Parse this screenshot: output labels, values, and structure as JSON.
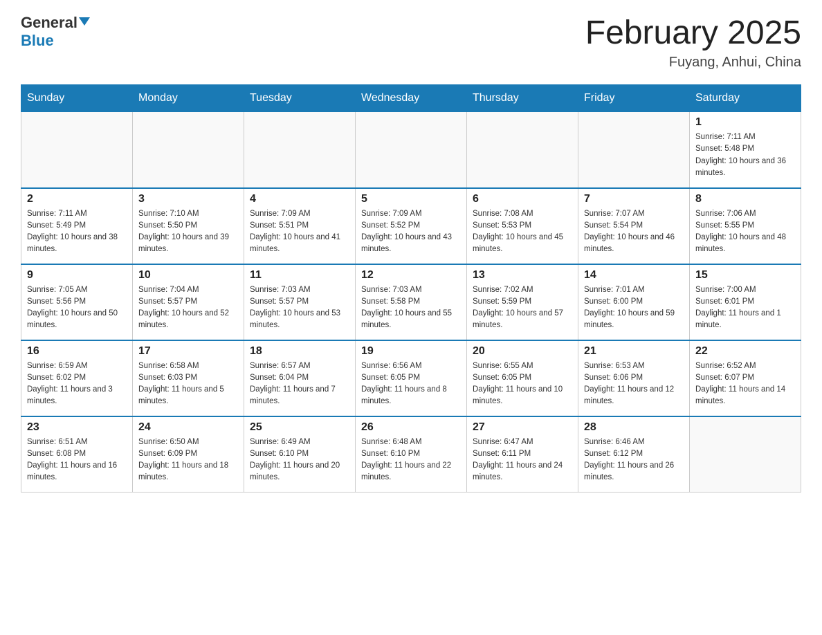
{
  "header": {
    "logo_general": "General",
    "logo_blue": "Blue",
    "month_title": "February 2025",
    "location": "Fuyang, Anhui, China"
  },
  "days_of_week": [
    "Sunday",
    "Monday",
    "Tuesday",
    "Wednesday",
    "Thursday",
    "Friday",
    "Saturday"
  ],
  "weeks": [
    [
      {
        "day": "",
        "sunrise": "",
        "sunset": "",
        "daylight": ""
      },
      {
        "day": "",
        "sunrise": "",
        "sunset": "",
        "daylight": ""
      },
      {
        "day": "",
        "sunrise": "",
        "sunset": "",
        "daylight": ""
      },
      {
        "day": "",
        "sunrise": "",
        "sunset": "",
        "daylight": ""
      },
      {
        "day": "",
        "sunrise": "",
        "sunset": "",
        "daylight": ""
      },
      {
        "day": "",
        "sunrise": "",
        "sunset": "",
        "daylight": ""
      },
      {
        "day": "1",
        "sunrise": "Sunrise: 7:11 AM",
        "sunset": "Sunset: 5:48 PM",
        "daylight": "Daylight: 10 hours and 36 minutes."
      }
    ],
    [
      {
        "day": "2",
        "sunrise": "Sunrise: 7:11 AM",
        "sunset": "Sunset: 5:49 PM",
        "daylight": "Daylight: 10 hours and 38 minutes."
      },
      {
        "day": "3",
        "sunrise": "Sunrise: 7:10 AM",
        "sunset": "Sunset: 5:50 PM",
        "daylight": "Daylight: 10 hours and 39 minutes."
      },
      {
        "day": "4",
        "sunrise": "Sunrise: 7:09 AM",
        "sunset": "Sunset: 5:51 PM",
        "daylight": "Daylight: 10 hours and 41 minutes."
      },
      {
        "day": "5",
        "sunrise": "Sunrise: 7:09 AM",
        "sunset": "Sunset: 5:52 PM",
        "daylight": "Daylight: 10 hours and 43 minutes."
      },
      {
        "day": "6",
        "sunrise": "Sunrise: 7:08 AM",
        "sunset": "Sunset: 5:53 PM",
        "daylight": "Daylight: 10 hours and 45 minutes."
      },
      {
        "day": "7",
        "sunrise": "Sunrise: 7:07 AM",
        "sunset": "Sunset: 5:54 PM",
        "daylight": "Daylight: 10 hours and 46 minutes."
      },
      {
        "day": "8",
        "sunrise": "Sunrise: 7:06 AM",
        "sunset": "Sunset: 5:55 PM",
        "daylight": "Daylight: 10 hours and 48 minutes."
      }
    ],
    [
      {
        "day": "9",
        "sunrise": "Sunrise: 7:05 AM",
        "sunset": "Sunset: 5:56 PM",
        "daylight": "Daylight: 10 hours and 50 minutes."
      },
      {
        "day": "10",
        "sunrise": "Sunrise: 7:04 AM",
        "sunset": "Sunset: 5:57 PM",
        "daylight": "Daylight: 10 hours and 52 minutes."
      },
      {
        "day": "11",
        "sunrise": "Sunrise: 7:03 AM",
        "sunset": "Sunset: 5:57 PM",
        "daylight": "Daylight: 10 hours and 53 minutes."
      },
      {
        "day": "12",
        "sunrise": "Sunrise: 7:03 AM",
        "sunset": "Sunset: 5:58 PM",
        "daylight": "Daylight: 10 hours and 55 minutes."
      },
      {
        "day": "13",
        "sunrise": "Sunrise: 7:02 AM",
        "sunset": "Sunset: 5:59 PM",
        "daylight": "Daylight: 10 hours and 57 minutes."
      },
      {
        "day": "14",
        "sunrise": "Sunrise: 7:01 AM",
        "sunset": "Sunset: 6:00 PM",
        "daylight": "Daylight: 10 hours and 59 minutes."
      },
      {
        "day": "15",
        "sunrise": "Sunrise: 7:00 AM",
        "sunset": "Sunset: 6:01 PM",
        "daylight": "Daylight: 11 hours and 1 minute."
      }
    ],
    [
      {
        "day": "16",
        "sunrise": "Sunrise: 6:59 AM",
        "sunset": "Sunset: 6:02 PM",
        "daylight": "Daylight: 11 hours and 3 minutes."
      },
      {
        "day": "17",
        "sunrise": "Sunrise: 6:58 AM",
        "sunset": "Sunset: 6:03 PM",
        "daylight": "Daylight: 11 hours and 5 minutes."
      },
      {
        "day": "18",
        "sunrise": "Sunrise: 6:57 AM",
        "sunset": "Sunset: 6:04 PM",
        "daylight": "Daylight: 11 hours and 7 minutes."
      },
      {
        "day": "19",
        "sunrise": "Sunrise: 6:56 AM",
        "sunset": "Sunset: 6:05 PM",
        "daylight": "Daylight: 11 hours and 8 minutes."
      },
      {
        "day": "20",
        "sunrise": "Sunrise: 6:55 AM",
        "sunset": "Sunset: 6:05 PM",
        "daylight": "Daylight: 11 hours and 10 minutes."
      },
      {
        "day": "21",
        "sunrise": "Sunrise: 6:53 AM",
        "sunset": "Sunset: 6:06 PM",
        "daylight": "Daylight: 11 hours and 12 minutes."
      },
      {
        "day": "22",
        "sunrise": "Sunrise: 6:52 AM",
        "sunset": "Sunset: 6:07 PM",
        "daylight": "Daylight: 11 hours and 14 minutes."
      }
    ],
    [
      {
        "day": "23",
        "sunrise": "Sunrise: 6:51 AM",
        "sunset": "Sunset: 6:08 PM",
        "daylight": "Daylight: 11 hours and 16 minutes."
      },
      {
        "day": "24",
        "sunrise": "Sunrise: 6:50 AM",
        "sunset": "Sunset: 6:09 PM",
        "daylight": "Daylight: 11 hours and 18 minutes."
      },
      {
        "day": "25",
        "sunrise": "Sunrise: 6:49 AM",
        "sunset": "Sunset: 6:10 PM",
        "daylight": "Daylight: 11 hours and 20 minutes."
      },
      {
        "day": "26",
        "sunrise": "Sunrise: 6:48 AM",
        "sunset": "Sunset: 6:10 PM",
        "daylight": "Daylight: 11 hours and 22 minutes."
      },
      {
        "day": "27",
        "sunrise": "Sunrise: 6:47 AM",
        "sunset": "Sunset: 6:11 PM",
        "daylight": "Daylight: 11 hours and 24 minutes."
      },
      {
        "day": "28",
        "sunrise": "Sunrise: 6:46 AM",
        "sunset": "Sunset: 6:12 PM",
        "daylight": "Daylight: 11 hours and 26 minutes."
      },
      {
        "day": "",
        "sunrise": "",
        "sunset": "",
        "daylight": ""
      }
    ]
  ]
}
